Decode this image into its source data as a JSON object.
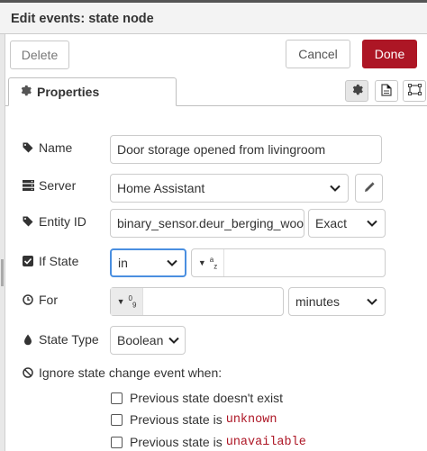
{
  "dialog": {
    "title": "Edit events: state node",
    "delete_label": "Delete",
    "cancel_label": "Cancel",
    "done_label": "Done",
    "done_color": "#ad1625"
  },
  "tabs": [
    {
      "label": "Properties",
      "icon": "gear-icon"
    }
  ],
  "tab_icons": [
    "gear-icon",
    "description-icon",
    "appearance-icon"
  ],
  "form": {
    "name": {
      "label": "Name",
      "value": "Door storage opened from livingroom"
    },
    "server": {
      "label": "Server",
      "value": "Home Assistant"
    },
    "entity_id": {
      "label": "Entity ID",
      "value": "binary_sensor.deur_berging_woonk",
      "match": "Exact"
    },
    "if_state": {
      "label": "If State",
      "operator": "in",
      "type_glyph": "az",
      "value": ""
    },
    "for": {
      "label": "For",
      "type_glyph": "09",
      "value": "",
      "unit": "minutes"
    },
    "state_type": {
      "label": "State Type",
      "value": "Boolean"
    },
    "ignore": {
      "label": "Ignore state change event when:",
      "options": [
        {
          "text": "Previous state doesn't exist",
          "code": "",
          "checked": false
        },
        {
          "text": "Previous state is",
          "code": "unknown",
          "checked": false
        },
        {
          "text": "Previous state is",
          "code": "unavailable",
          "checked": false
        }
      ]
    }
  }
}
